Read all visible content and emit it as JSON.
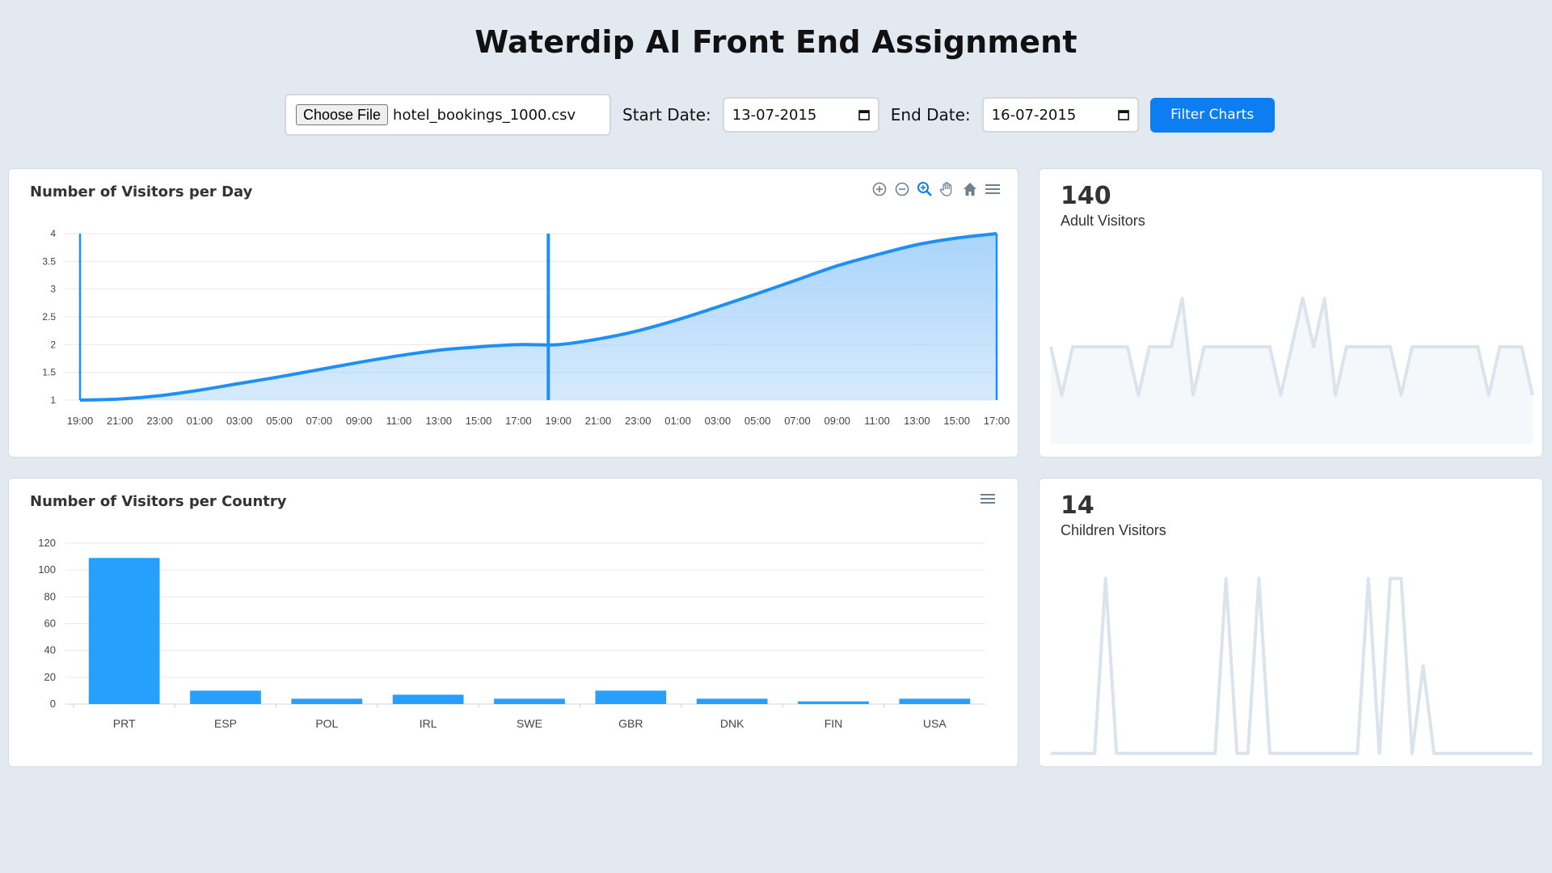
{
  "page": {
    "title": "Waterdip AI Front End Assignment"
  },
  "controls": {
    "choose_file_label": "Choose File",
    "file_name": "hotel_bookings_1000.csv",
    "start_label": "Start Date:",
    "start_value": "13-07-2015",
    "end_label": "End Date:",
    "end_value": "16-07-2015",
    "filter_label": "Filter Charts"
  },
  "colors": {
    "accent": "#0d7ef2",
    "series": "#1e90f5",
    "area": "#a5d2fa",
    "sparkline": "#dbe4ec"
  },
  "icons": [
    "zoom-in-icon",
    "zoom-out-icon",
    "selection-zoom-icon",
    "pan-icon",
    "home-icon",
    "menu-icon"
  ],
  "chart_data": [
    {
      "type": "area",
      "title": "Number of Visitors per Day",
      "x": [
        "19:00",
        "21:00",
        "23:00",
        "01:00",
        "03:00",
        "05:00",
        "07:00",
        "09:00",
        "11:00",
        "13:00",
        "15:00",
        "17:00",
        "19:00",
        "21:00",
        "23:00",
        "01:00",
        "03:00",
        "05:00",
        "07:00",
        "09:00",
        "11:00",
        "13:00",
        "15:00",
        "17:00"
      ],
      "series": [
        {
          "values": [
            1,
            1.02,
            1.08,
            1.18,
            1.3,
            1.42,
            1.55,
            1.68,
            1.8,
            1.9,
            1.96,
            2,
            2,
            2.1,
            2.25,
            2.45,
            2.68,
            2.92,
            3.17,
            3.42,
            3.62,
            3.8,
            3.92,
            4
          ]
        }
      ],
      "yticks": [
        "1",
        "1.5",
        "2",
        "2.5",
        "3",
        "3.5",
        "4"
      ],
      "ylim": [
        1,
        4
      ],
      "grid": true
    },
    {
      "type": "bar",
      "title": "Number of Visitors per Country",
      "categories": [
        "PRT",
        "ESP",
        "POL",
        "IRL",
        "SWE",
        "GBR",
        "DNK",
        "FIN",
        "USA"
      ],
      "values": [
        109,
        10,
        4,
        7,
        4,
        10,
        4,
        2,
        4
      ],
      "yticks": [
        "0",
        "20",
        "40",
        "60",
        "80",
        "100",
        "120"
      ],
      "ylim": [
        0,
        120
      ],
      "grid": true
    },
    {
      "type": "line",
      "series": [
        {
          "values": [
            2,
            1,
            2,
            2,
            2,
            2,
            2,
            2,
            1,
            2,
            2,
            2,
            3,
            1,
            2,
            2,
            2,
            2,
            2,
            2,
            2,
            1,
            2,
            3,
            2,
            3,
            1,
            2,
            2,
            2,
            2,
            2,
            1,
            2,
            2,
            2,
            2,
            2,
            2,
            2,
            1,
            2,
            2,
            2,
            1
          ]
        }
      ],
      "ylim": [
        0,
        4
      ]
    },
    {
      "type": "line",
      "series": [
        {
          "values": [
            0,
            0,
            0,
            0,
            0,
            2,
            0,
            0,
            0,
            0,
            0,
            0,
            0,
            0,
            0,
            0,
            2,
            0,
            0,
            2,
            0,
            0,
            0,
            0,
            0,
            0,
            0,
            0,
            0,
            2,
            0,
            2,
            2,
            0,
            1,
            0,
            0,
            0,
            0,
            0,
            0,
            0,
            0,
            0,
            0
          ]
        }
      ],
      "ylim": [
        0,
        2.2
      ]
    }
  ],
  "stats": {
    "adult": {
      "value": "140",
      "label": "Adult Visitors"
    },
    "children": {
      "value": "14",
      "label": "Children Visitors"
    }
  }
}
